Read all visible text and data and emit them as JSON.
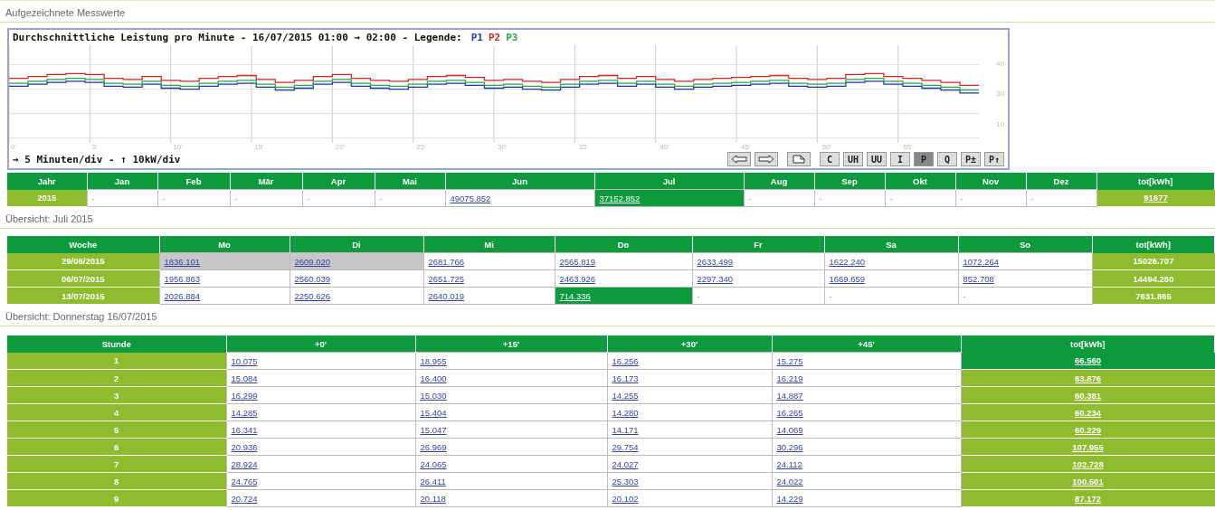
{
  "section_title": "Aufgezeichnete Messwerte",
  "chart": {
    "title": "Durchschnittliche Leistung pro Minute - 16/07/2015 01:00 → 02:00 - Legende:",
    "legend": [
      {
        "label": "P1",
        "color": "#2233aa"
      },
      {
        "label": "P2",
        "color": "#dd2222"
      },
      {
        "label": "P3",
        "color": "#22aa44"
      }
    ],
    "x_labels": [
      "0'",
      "5'",
      "10'",
      "15'",
      "20'",
      "25'",
      "30'",
      "35'",
      "40'",
      "45'",
      "50'",
      "55'"
    ],
    "y_labels": [
      "40",
      "30",
      "10"
    ],
    "scale_note": "→ 5 Minuten/div - ↑ 10kW/div",
    "buttons": [
      {
        "kind": "prev",
        "selected": false
      },
      {
        "kind": "next",
        "selected": false
      },
      {
        "kind": "export",
        "selected": false
      },
      {
        "kind": "text",
        "label": "C",
        "selected": false
      },
      {
        "kind": "text",
        "label": "UH",
        "selected": false
      },
      {
        "kind": "text",
        "label": "UU",
        "selected": false
      },
      {
        "kind": "text",
        "label": "I",
        "selected": false
      },
      {
        "kind": "text",
        "label": "P",
        "selected": true
      },
      {
        "kind": "text",
        "label": "Q",
        "selected": false
      },
      {
        "kind": "text",
        "label": "P±",
        "selected": false
      },
      {
        "kind": "text",
        "label": "P↑",
        "selected": false
      }
    ]
  },
  "year_table": {
    "columns": [
      "Jahr",
      "Jan",
      "Feb",
      "Mär",
      "Apr",
      "Mai",
      "Jun",
      "Jul",
      "Aug",
      "Sep",
      "Okt",
      "Nov",
      "Dez",
      "tot[kWh]"
    ],
    "rows": [
      {
        "cells": [
          {
            "kind": "label",
            "text": "2015"
          },
          {
            "kind": "value",
            "text": "-",
            "link": false,
            "selected": false
          },
          {
            "kind": "value",
            "text": "-",
            "link": false,
            "selected": false
          },
          {
            "kind": "value",
            "text": "-",
            "link": false,
            "selected": false
          },
          {
            "kind": "value",
            "text": "-",
            "link": false,
            "selected": false
          },
          {
            "kind": "value",
            "text": "-",
            "link": false,
            "selected": false
          },
          {
            "kind": "value",
            "text": "49075.852",
            "link": true,
            "selected": false
          },
          {
            "kind": "value",
            "text": "37152.852",
            "link": true,
            "selected": true
          },
          {
            "kind": "value",
            "text": "-",
            "link": false,
            "selected": false
          },
          {
            "kind": "value",
            "text": "-",
            "link": false,
            "selected": false
          },
          {
            "kind": "value",
            "text": "-",
            "link": false,
            "selected": false
          },
          {
            "kind": "value",
            "text": "-",
            "link": false,
            "selected": false
          },
          {
            "kind": "value",
            "text": "-",
            "link": false,
            "selected": false
          },
          {
            "kind": "total",
            "text": "91677",
            "link": true,
            "selected": false
          }
        ]
      }
    ]
  },
  "month_title": "Übersicht: Juli 2015",
  "week_table": {
    "columns": [
      "Woche",
      "Mo",
      "Di",
      "Mi",
      "Do",
      "Fr",
      "Sa",
      "So",
      "tot[kWh]"
    ],
    "rows": [
      {
        "cells": [
          {
            "kind": "label",
            "text": "29/06/2015"
          },
          {
            "kind": "value",
            "text": "1836.101",
            "link": true,
            "selected": false,
            "shaded": true
          },
          {
            "kind": "value",
            "text": "2609.020",
            "link": true,
            "selected": false,
            "shaded": true
          },
          {
            "kind": "value",
            "text": "2681.766",
            "link": true,
            "selected": false,
            "shaded": false
          },
          {
            "kind": "value",
            "text": "2565.819",
            "link": true,
            "selected": false,
            "shaded": false
          },
          {
            "kind": "value",
            "text": "2633.499",
            "link": true,
            "selected": false,
            "shaded": false
          },
          {
            "kind": "value",
            "text": "1622.240",
            "link": true,
            "selected": false,
            "shaded": false
          },
          {
            "kind": "value",
            "text": "1072.264",
            "link": true,
            "selected": false,
            "shaded": false
          },
          {
            "kind": "total",
            "text": "15026.707",
            "link": false,
            "selected": false
          }
        ]
      },
      {
        "cells": [
          {
            "kind": "label",
            "text": "06/07/2015"
          },
          {
            "kind": "value",
            "text": "1956.863",
            "link": true,
            "selected": false,
            "shaded": false
          },
          {
            "kind": "value",
            "text": "2560.039",
            "link": true,
            "selected": false,
            "shaded": false
          },
          {
            "kind": "value",
            "text": "2651.725",
            "link": true,
            "selected": false,
            "shaded": false
          },
          {
            "kind": "value",
            "text": "2463.926",
            "link": true,
            "selected": false,
            "shaded": false
          },
          {
            "kind": "value",
            "text": "2297.340",
            "link": true,
            "selected": false,
            "shaded": false
          },
          {
            "kind": "value",
            "text": "1669.659",
            "link": true,
            "selected": false,
            "shaded": false
          },
          {
            "kind": "value",
            "text": "852.708",
            "link": true,
            "selected": false,
            "shaded": false
          },
          {
            "kind": "total",
            "text": "14494.280",
            "link": false,
            "selected": false
          }
        ]
      },
      {
        "cells": [
          {
            "kind": "label",
            "text": "13/07/2015"
          },
          {
            "kind": "value",
            "text": "2026.884",
            "link": true,
            "selected": false,
            "shaded": false
          },
          {
            "kind": "value",
            "text": "2250.626",
            "link": true,
            "selected": false,
            "shaded": false
          },
          {
            "kind": "value",
            "text": "2640.019",
            "link": true,
            "selected": false,
            "shaded": false
          },
          {
            "kind": "value",
            "text": "714.336",
            "link": true,
            "selected": true,
            "shaded": false
          },
          {
            "kind": "value",
            "text": "-",
            "link": false,
            "selected": false,
            "shaded": false
          },
          {
            "kind": "value",
            "text": "-",
            "link": false,
            "selected": false,
            "shaded": false
          },
          {
            "kind": "value",
            "text": "-",
            "link": false,
            "selected": false,
            "shaded": false
          },
          {
            "kind": "total",
            "text": "7631.865",
            "link": false,
            "selected": false
          }
        ]
      }
    ]
  },
  "day_title": "Übersicht: Donnerstag 16/07/2015",
  "hour_table": {
    "columns": [
      "Stunde",
      "+0'",
      "+15'",
      "+30'",
      "+45'",
      "tot[kWh]"
    ],
    "rows": [
      {
        "cells": [
          {
            "kind": "label",
            "text": "1"
          },
          {
            "kind": "value",
            "text": "10.075",
            "link": true
          },
          {
            "kind": "value",
            "text": "18.955",
            "link": true
          },
          {
            "kind": "value",
            "text": "16.256",
            "link": true
          },
          {
            "kind": "value",
            "text": "15.275",
            "link": true
          },
          {
            "kind": "total",
            "text": "66.560",
            "link": true,
            "selected": true
          }
        ]
      },
      {
        "cells": [
          {
            "kind": "label",
            "text": "2"
          },
          {
            "kind": "value",
            "text": "15.084",
            "link": true
          },
          {
            "kind": "value",
            "text": "16.400",
            "link": true
          },
          {
            "kind": "value",
            "text": "16.173",
            "link": true
          },
          {
            "kind": "value",
            "text": "16.219",
            "link": true
          },
          {
            "kind": "total",
            "text": "63.876",
            "link": true,
            "selected": false
          }
        ]
      },
      {
        "cells": [
          {
            "kind": "label",
            "text": "3"
          },
          {
            "kind": "value",
            "text": "16.299",
            "link": true
          },
          {
            "kind": "value",
            "text": "15.030",
            "link": true
          },
          {
            "kind": "value",
            "text": "14.255",
            "link": true
          },
          {
            "kind": "value",
            "text": "14.887",
            "link": true
          },
          {
            "kind": "total",
            "text": "60.381",
            "link": true,
            "selected": false
          }
        ]
      },
      {
        "cells": [
          {
            "kind": "label",
            "text": "4"
          },
          {
            "kind": "value",
            "text": "14.285",
            "link": true
          },
          {
            "kind": "value",
            "text": "15.404",
            "link": true
          },
          {
            "kind": "value",
            "text": "14.280",
            "link": true
          },
          {
            "kind": "value",
            "text": "16.265",
            "link": true
          },
          {
            "kind": "total",
            "text": "60.234",
            "link": true,
            "selected": false
          }
        ]
      },
      {
        "cells": [
          {
            "kind": "label",
            "text": "5"
          },
          {
            "kind": "value",
            "text": "16.341",
            "link": true
          },
          {
            "kind": "value",
            "text": "15.047",
            "link": true
          },
          {
            "kind": "value",
            "text": "14.171",
            "link": true
          },
          {
            "kind": "value",
            "text": "14.069",
            "link": true
          },
          {
            "kind": "total",
            "text": "60.229",
            "link": true,
            "selected": false
          }
        ]
      },
      {
        "cells": [
          {
            "kind": "label",
            "text": "6"
          },
          {
            "kind": "value",
            "text": "20.936",
            "link": true
          },
          {
            "kind": "value",
            "text": "26.969",
            "link": true
          },
          {
            "kind": "value",
            "text": "29.754",
            "link": true
          },
          {
            "kind": "value",
            "text": "30.296",
            "link": true
          },
          {
            "kind": "total",
            "text": "107.955",
            "link": true,
            "selected": false
          }
        ]
      },
      {
        "cells": [
          {
            "kind": "label",
            "text": "7"
          },
          {
            "kind": "value",
            "text": "28.924",
            "link": true
          },
          {
            "kind": "value",
            "text": "24.065",
            "link": true
          },
          {
            "kind": "value",
            "text": "24.027",
            "link": true
          },
          {
            "kind": "value",
            "text": "24.112",
            "link": true
          },
          {
            "kind": "total",
            "text": "102.728",
            "link": true,
            "selected": false
          }
        ]
      },
      {
        "cells": [
          {
            "kind": "label",
            "text": "8"
          },
          {
            "kind": "value",
            "text": "24.765",
            "link": true
          },
          {
            "kind": "value",
            "text": "26.411",
            "link": true
          },
          {
            "kind": "value",
            "text": "25.303",
            "link": true
          },
          {
            "kind": "value",
            "text": "24.022",
            "link": true
          },
          {
            "kind": "total",
            "text": "100.501",
            "link": true,
            "selected": false
          }
        ]
      },
      {
        "cells": [
          {
            "kind": "label",
            "text": "9"
          },
          {
            "kind": "value",
            "text": "20.724",
            "link": true
          },
          {
            "kind": "value",
            "text": "20.118",
            "link": true
          },
          {
            "kind": "value",
            "text": "20.102",
            "link": true
          },
          {
            "kind": "value",
            "text": "14.229",
            "link": true
          },
          {
            "kind": "total",
            "text": "87.172",
            "link": true,
            "selected": false
          }
        ]
      }
    ]
  }
}
